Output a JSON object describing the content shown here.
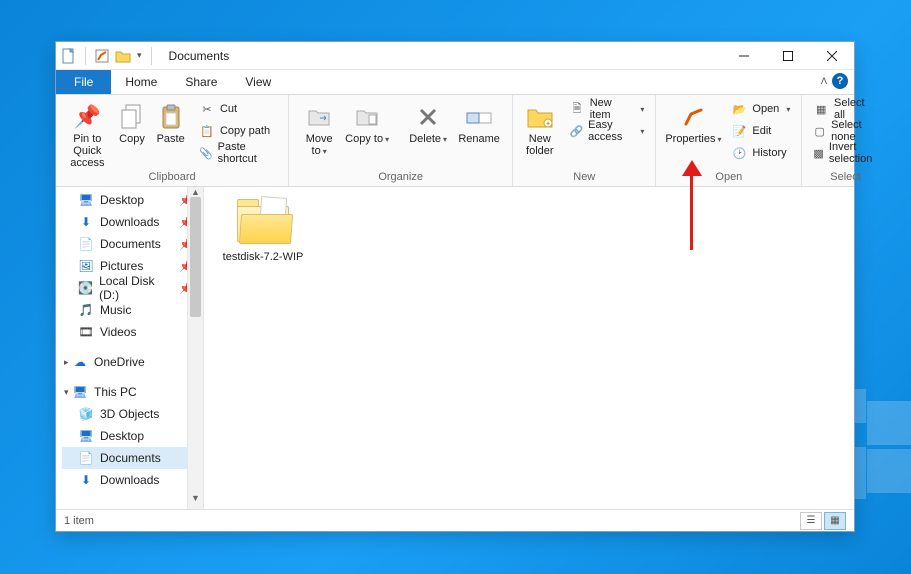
{
  "title": "Documents",
  "tabs": {
    "file": "File",
    "home": "Home",
    "share": "Share",
    "view": "View"
  },
  "ribbon": {
    "clipboard": {
      "label": "Clipboard",
      "pin": "Pin to Quick access",
      "copy": "Copy",
      "paste": "Paste",
      "cut": "Cut",
      "copy_path": "Copy path",
      "paste_shortcut": "Paste shortcut"
    },
    "organize": {
      "label": "Organize",
      "move_to": "Move to",
      "copy_to": "Copy to",
      "delete": "Delete",
      "rename": "Rename"
    },
    "new": {
      "label": "New",
      "new_folder": "New folder",
      "new_item": "New item",
      "easy_access": "Easy access"
    },
    "open": {
      "label": "Open",
      "properties": "Properties",
      "open": "Open",
      "edit": "Edit",
      "history": "History"
    },
    "select": {
      "label": "Select",
      "select_all": "Select all",
      "select_none": "Select none",
      "invert": "Invert selection"
    }
  },
  "nav": {
    "quick_access": [
      {
        "label": "Desktop",
        "pinned": true
      },
      {
        "label": "Downloads",
        "pinned": true
      },
      {
        "label": "Documents",
        "pinned": true
      },
      {
        "label": "Pictures",
        "pinned": true
      },
      {
        "label": "Local Disk (D:)",
        "pinned": true
      },
      {
        "label": "Music",
        "pinned": false
      },
      {
        "label": "Videos",
        "pinned": false
      }
    ],
    "onedrive": "OneDrive",
    "this_pc": {
      "label": "This PC",
      "children": [
        {
          "label": "3D Objects"
        },
        {
          "label": "Desktop"
        },
        {
          "label": "Documents",
          "selected": true
        },
        {
          "label": "Downloads"
        }
      ]
    }
  },
  "files": [
    {
      "name": "testdisk-7.2-WIP",
      "type": "folder"
    }
  ],
  "status": {
    "count": "1 item"
  }
}
